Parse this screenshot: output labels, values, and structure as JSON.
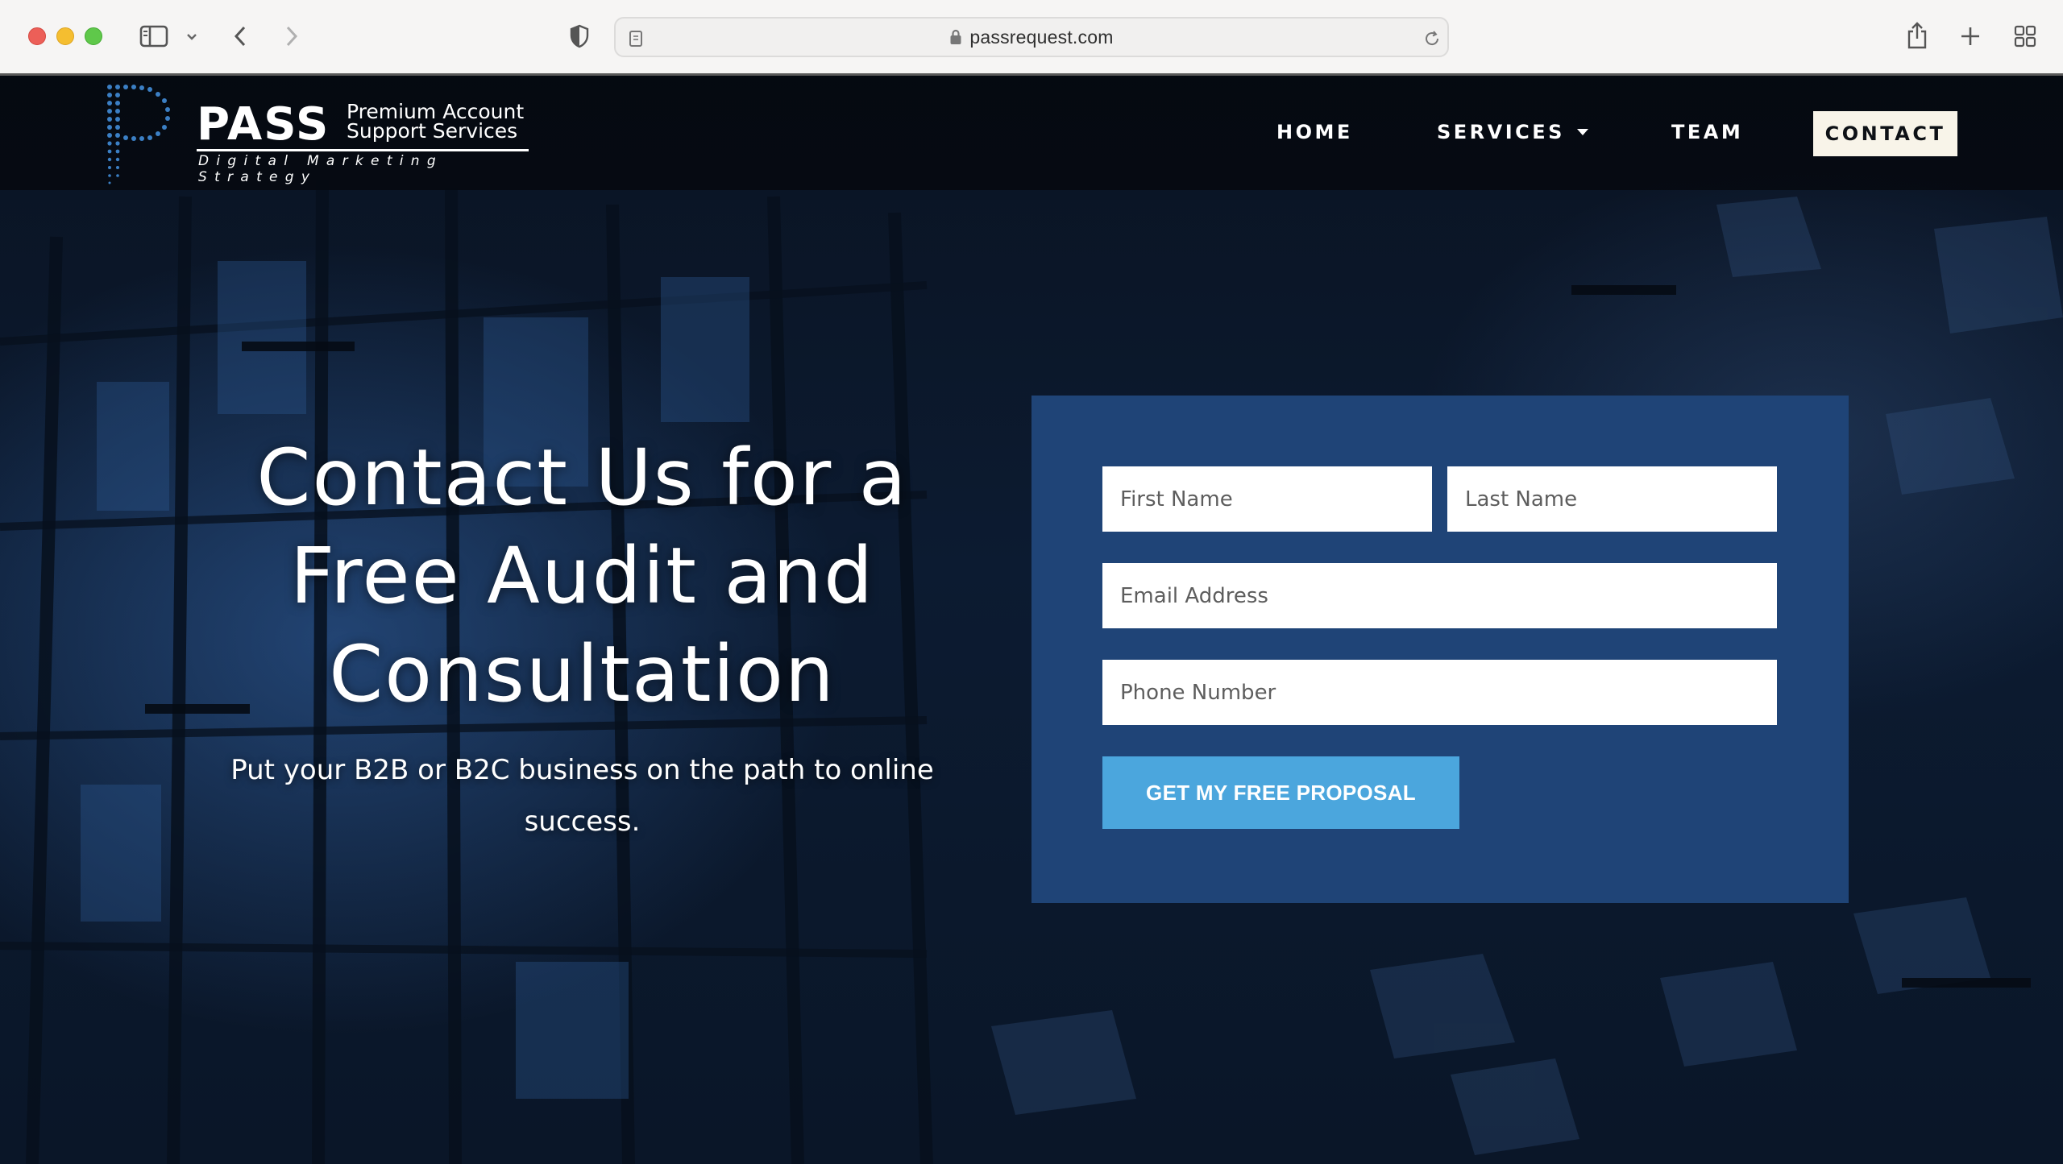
{
  "browser": {
    "url": "passrequest.com"
  },
  "logo": {
    "brand": "PASS",
    "line1": "Premium Account",
    "line2": "Support Services",
    "tagline": "Digital Marketing Strategy"
  },
  "nav": {
    "home": "HOME",
    "services": "SERVICES",
    "team": "TEAM",
    "contact": "CONTACT"
  },
  "hero": {
    "title": "Contact Us for a Free Audit and Consultation",
    "subtitle": "Put your B2B or B2C business on the path to online success."
  },
  "form": {
    "first_name_placeholder": "First Name",
    "last_name_placeholder": "Last Name",
    "email_placeholder": "Email Address",
    "phone_placeholder": "Phone Number",
    "submit_label": "GET MY FREE PROPOSAL"
  },
  "colors": {
    "form_panel": "#1f4477",
    "submit_button": "#4ba6dd",
    "contact_button": "#f8f4e9"
  }
}
